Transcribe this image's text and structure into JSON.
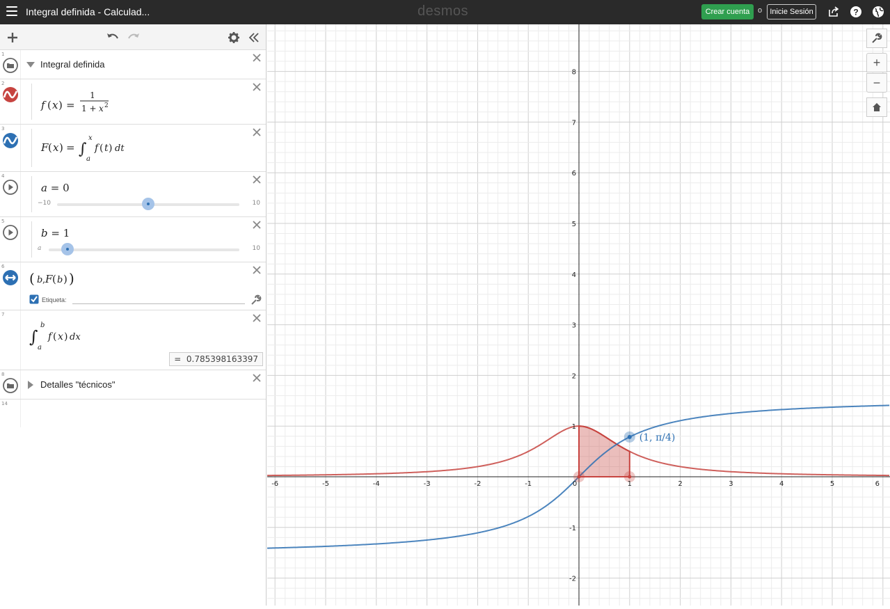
{
  "topbar": {
    "title": "Integral definida - Calculad...",
    "logo": "desmos",
    "create_account": "Crear cuenta",
    "or": "o",
    "login": "Inicie Sesión"
  },
  "expressions": [
    {
      "num": "1",
      "type": "folder",
      "label": "Integral definida"
    },
    {
      "num": "2",
      "type": "expression",
      "color": "#c74440"
    },
    {
      "num": "3",
      "type": "expression",
      "color": "#2d70b3"
    },
    {
      "num": "4",
      "type": "slider",
      "variable": "a",
      "value": "0",
      "min": "−10",
      "max": "10"
    },
    {
      "num": "5",
      "type": "slider",
      "variable": "b",
      "value": "1",
      "min": "a",
      "max": "10"
    },
    {
      "num": "6",
      "type": "point",
      "color": "#2d70b3",
      "label_caption": "Etiqueta:"
    },
    {
      "num": "7",
      "type": "integral",
      "result": "0.785398163397"
    },
    {
      "num": "8",
      "type": "folder",
      "label": "Detalles \"técnicos\""
    },
    {
      "num": "14",
      "type": "empty"
    }
  ],
  "graph": {
    "x_ticks": [
      "-6",
      "-5",
      "-4",
      "-3",
      "-2",
      "-1",
      "0",
      "1",
      "2",
      "3",
      "4",
      "5",
      "6"
    ],
    "y_ticks": [
      "8",
      "7",
      "6",
      "5",
      "4",
      "3",
      "2",
      "1",
      "-1",
      "-2"
    ],
    "point_label": "(1, π/4)",
    "colors": {
      "red": "#c74440",
      "blue": "#2d70b3",
      "fill": "#c74440"
    },
    "buttons": [
      "wrench-icon",
      "zoom-in-icon",
      "zoom-out-icon",
      "home-icon"
    ]
  }
}
